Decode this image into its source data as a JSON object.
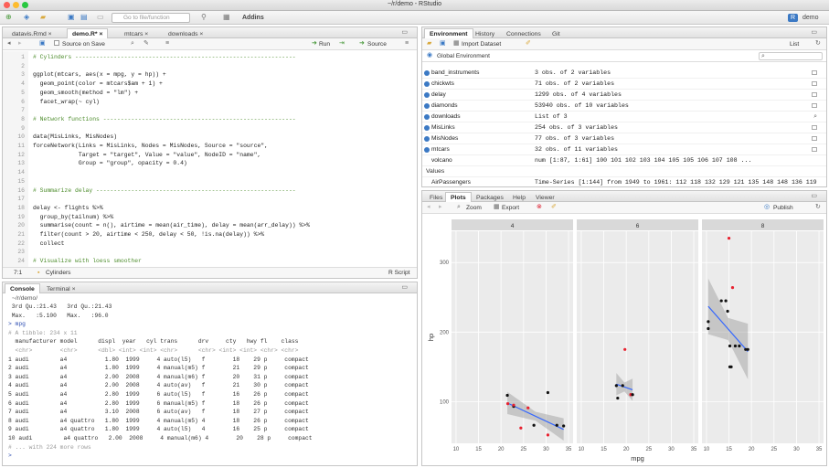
{
  "window": {
    "title": "~/r/demo - RStudio"
  },
  "toolbar": {
    "goto_placeholder": "Go to file/function",
    "addins": "Addins",
    "project": "demo"
  },
  "editor": {
    "tabs": [
      "datavis.Rmd",
      "demo.R*",
      "mtcars",
      "downloads"
    ],
    "source_on_save": "Source on Save",
    "run": "Run",
    "source": "Source",
    "lines": [
      "# Cylinders ---------------------------------------------------------------",
      "",
      "ggplot(mtcars, aes(x = mpg, y = hp)) +",
      "  geom_point(color = mtcars$am + 1) +",
      "  geom_smooth(method = \"lm\") +",
      "  facet_wrap(~ cyl)",
      "",
      "# Network functions -------------------------------------------------------",
      "",
      "data(MisLinks, MisNodes)",
      "forceNetwork(Links = MisLinks, Nodes = MisNodes, Source = \"source\",",
      "             Target = \"target\", Value = \"value\", NodeID = \"name\",",
      "             Group = \"group\", opacity = 0.4)",
      "",
      "",
      "# Summarize delay ---------------------------------------------------------",
      "",
      "delay <- flights %>%",
      "  group_by(tailnum) %>%",
      "  summarise(count = n(), airtime = mean(air_time), delay = mean(arr_delay)) %>%",
      "  filter(count > 20, airtime < 250, delay < 50, !is.na(delay)) %>%",
      "  collect",
      "",
      "# Visualize with loess smoother",
      ""
    ],
    "status_pos": "7:1",
    "status_section": "Cylinders",
    "status_type": "R Script"
  },
  "console": {
    "tabs": [
      "Console",
      "Terminal"
    ],
    "path": "~/r/demo/",
    "pre_lines": [
      " 3rd Qu.:21.43   3rd Qu.:21.43",
      " Max.   :5.100   Max.   :96.0"
    ],
    "command": "> mpg",
    "tibble_info": "# A tibble: 234 x 11",
    "header": "  manufacturer model      displ  year   cyl trans      drv     cty   hwy fl    class",
    "types": "  <chr>        <chr>      <dbl> <int> <int> <chr>      <chr> <int> <int> <chr> <chr>",
    "rows": [
      "1 audi         a4           1.80  1999     4 auto(l5)   f        18    29 p     compact",
      "2 audi         a4           1.80  1999     4 manual(m5) f        21    29 p     compact",
      "3 audi         a4           2.00  2008     4 manual(m6) f        20    31 p     compact",
      "4 audi         a4           2.00  2008     4 auto(av)   f        21    30 p     compact",
      "5 audi         a4           2.80  1999     6 auto(l5)   f        16    26 p     compact",
      "6 audi         a4           2.80  1999     6 manual(m5) f        18    26 p     compact",
      "7 audi         a4           3.10  2008     6 auto(av)   f        18    27 p     compact",
      "8 audi         a4 quattro   1.80  1999     4 manual(m5) 4        18    26 p     compact",
      "9 audi         a4 quattro   1.80  1999     4 auto(l5)   4        16    25 p     compact",
      "10 audi         a4 quattro   2.00  2008     4 manual(m6) 4        20    28 p     compact"
    ],
    "more": "# ... with 224 more rows",
    "prompt": ">"
  },
  "environment": {
    "tabs": [
      "Environment",
      "History",
      "Connections",
      "Git"
    ],
    "import": "Import Dataset",
    "list": "List",
    "scope": "Global Environment",
    "items": [
      {
        "name": "band_instruments",
        "value": "3 obs. of 2 variables"
      },
      {
        "name": "chickwts",
        "value": "71 obs. of 2 variables"
      },
      {
        "name": "delay",
        "value": "1299 obs. of 4 variables"
      },
      {
        "name": "diamonds",
        "value": "53940 obs. of 10 variables"
      },
      {
        "name": "downloads",
        "value": "List of 3"
      },
      {
        "name": "MisLinks",
        "value": "254 obs. of 3 variables"
      },
      {
        "name": "MisNodes",
        "value": "77 obs. of 3 variables"
      },
      {
        "name": "mtcars",
        "value": "32 obs. of 11 variables"
      },
      {
        "name": "volcano",
        "value": "num [1:87, 1:61] 100 101 102 103 104 105 105 106 107 108 ..."
      }
    ],
    "values_header": "Values",
    "values": [
      {
        "name": "AirPassengers",
        "value": "Time-Series [1:144] from 1949 to 1961: 112 118 132 129 121 135 148 148 136 119 ..."
      }
    ]
  },
  "files": {
    "tabs": [
      "Files",
      "Plots",
      "Packages",
      "Help",
      "Viewer"
    ],
    "zoom": "Zoom",
    "export": "Export",
    "publish": "Publish"
  },
  "chart_data": {
    "type": "scatter",
    "xlabel": "mpg",
    "ylabel": "hp",
    "xlim": [
      9,
      36
    ],
    "ylim": [
      40,
      345
    ],
    "xticks": [
      "10",
      "15",
      "20",
      "25",
      "30",
      "35"
    ],
    "yticks": [
      100,
      200,
      300
    ],
    "facets": [
      {
        "label": "4",
        "points": [
          [
            22.8,
            93,
            "black"
          ],
          [
            24.4,
            62,
            "red"
          ],
          [
            22.8,
            95,
            "red"
          ],
          [
            32.4,
            66,
            "black"
          ],
          [
            30.4,
            52,
            "red"
          ],
          [
            33.9,
            65,
            "black"
          ],
          [
            21.5,
            97,
            "red"
          ],
          [
            27.3,
            66,
            "black"
          ],
          [
            26,
            91,
            "red"
          ],
          [
            30.4,
            113,
            "black"
          ],
          [
            21.4,
            109,
            "black"
          ]
        ],
        "fit": [
          [
            21.4,
            98
          ],
          [
            33.9,
            60
          ]
        ]
      },
      {
        "label": "6",
        "points": [
          [
            21,
            110,
            "red"
          ],
          [
            21,
            110,
            "red"
          ],
          [
            21.4,
            110,
            "black"
          ],
          [
            18.1,
            105,
            "black"
          ],
          [
            19.2,
            123,
            "black"
          ],
          [
            17.8,
            123,
            "black"
          ],
          [
            19.7,
            175,
            "red"
          ]
        ],
        "fit": [
          [
            17.8,
            125
          ],
          [
            21.4,
            117
          ]
        ]
      },
      {
        "label": "8",
        "points": [
          [
            18.7,
            175,
            "black"
          ],
          [
            14.3,
            245,
            "black"
          ],
          [
            16.4,
            180,
            "black"
          ],
          [
            17.3,
            180,
            "black"
          ],
          [
            15.2,
            180,
            "black"
          ],
          [
            10.4,
            205,
            "black"
          ],
          [
            10.4,
            215,
            "black"
          ],
          [
            14.7,
            230,
            "black"
          ],
          [
            15.5,
            150,
            "black"
          ],
          [
            15.2,
            150,
            "black"
          ],
          [
            13.3,
            245,
            "black"
          ],
          [
            19.2,
            175,
            "black"
          ],
          [
            15.8,
            264,
            "red"
          ],
          [
            15,
            335,
            "red"
          ]
        ],
        "fit": [
          [
            10.4,
            237
          ],
          [
            19.2,
            172
          ]
        ]
      }
    ]
  },
  "colors": {
    "accent": "#3b79c4",
    "fit_line": "#3366ff",
    "band": "#999999",
    "panel": "#ebebeb",
    "red_point": "#e8212f"
  }
}
